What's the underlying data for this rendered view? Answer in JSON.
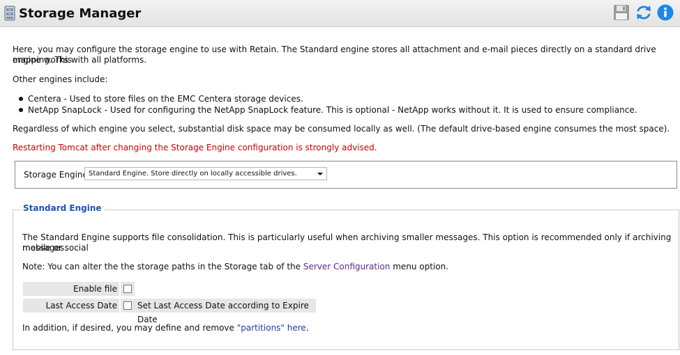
{
  "header": {
    "title": "Storage Manager",
    "app_icon": "server-cabinet-icon",
    "actions": [
      {
        "name": "save-icon",
        "label": "Save"
      },
      {
        "name": "refresh-icon",
        "label": "Refresh"
      },
      {
        "name": "info-icon",
        "label": "Info"
      }
    ]
  },
  "intro": {
    "paragraph1": "Here, you may configure the storage engine to use with Retain. The Standard engine stores all attachment and e-mail pieces directly on a standard drive mapping. This",
    "paragraph1b": "engine works with all platforms.",
    "other_engines": "Other engines include:",
    "engines": [
      "Centera - Used to store files on the EMC Centera storage devices.",
      "NetApp SnapLock - Used for configuring the NetApp SnapLock feature. This is optional - NetApp works without it. It is used to ensure compliance."
    ],
    "disk_note": "Regardless of which engine you select, substantial disk space may be consumed locally as well. (The default drive-based engine consumes the most space).",
    "warning": "Restarting Tomcat after changing the Storage Engine configuration is strongly advised."
  },
  "storage_engine": {
    "label": "Storage Engine",
    "selected": "Standard Engine. Store directly on locally accessible drives."
  },
  "standard_engine": {
    "legend": "Standard Engine",
    "description1": "The Standard Engine supports file consolidation. This is particularly useful when archiving smaller messages. This option is recommended only if archiving mobile or social",
    "description2": "messages.",
    "note_prefix": "Note: You can alter the the storage paths in the Storage tab of the ",
    "note_link": "Server Configuration",
    "note_suffix": " menu option.",
    "options": {
      "consolidation_label": "Enable file consolidation?",
      "consolidation_checked": false,
      "last_access_label": "Last Access Date",
      "last_access_checked": false,
      "last_access_text": "Set Last Access Date according to Expire Date"
    },
    "partitions_prefix": "In addition, if desired, you may define and remove ",
    "partitions_link": "\"partitions\" here",
    "partitions_suffix": "."
  },
  "colors": {
    "warning": "#cc0000",
    "legend": "#1a56b0",
    "info_icon": "#1e88e5",
    "refresh_icon": "#1e88e5",
    "link_visited": "#5b2a8a",
    "link": "#1f3ca8"
  }
}
